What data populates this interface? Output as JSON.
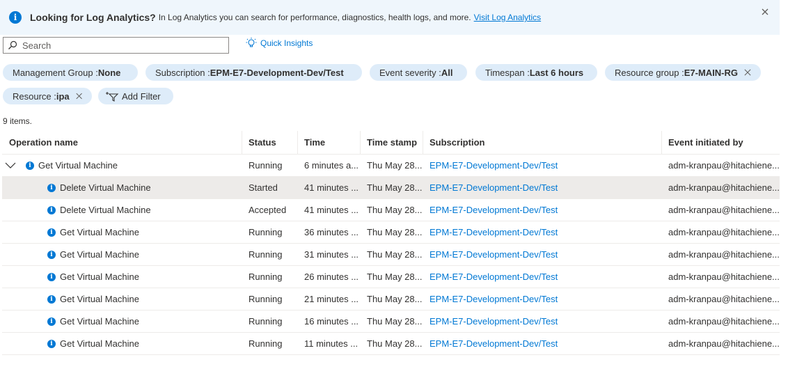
{
  "banner": {
    "title": "Looking for Log Analytics?",
    "message": "In Log Analytics you can search for performance, diagnostics, health logs, and more.",
    "link": "Visit Log Analytics"
  },
  "search": {
    "placeholder": "Search"
  },
  "quick_insights": "Quick Insights",
  "filters": {
    "management_group": {
      "label": "Management Group : ",
      "value": "None"
    },
    "subscription": {
      "label": "Subscription : ",
      "value": "EPM-E7-Development-Dev/Test"
    },
    "event_severity": {
      "label": "Event severity : ",
      "value": "All"
    },
    "timespan": {
      "label": "Timespan : ",
      "value": "Last 6 hours"
    },
    "resource_group": {
      "label": "Resource group : ",
      "value": "E7-MAIN-RG"
    },
    "resource": {
      "label": "Resource : ",
      "value": "ipa"
    },
    "add_filter": "Add Filter"
  },
  "item_count": "9 items.",
  "columns": [
    "Operation name",
    "Status",
    "Time",
    "Time stamp",
    "Subscription",
    "Event initiated by"
  ],
  "rows": [
    {
      "op": "Get Virtual Machine",
      "status": "Running",
      "time": "6 minutes a...",
      "stamp": "Thu May 28...",
      "sub": "EPM-E7-Development-Dev/Test",
      "by": "adm-kranpau@hitachiene..."
    },
    {
      "op": "Delete Virtual Machine",
      "status": "Started",
      "time": "41 minutes ...",
      "stamp": "Thu May 28...",
      "sub": "EPM-E7-Development-Dev/Test",
      "by": "adm-kranpau@hitachiene..."
    },
    {
      "op": "Delete Virtual Machine",
      "status": "Accepted",
      "time": "41 minutes ...",
      "stamp": "Thu May 28...",
      "sub": "EPM-E7-Development-Dev/Test",
      "by": "adm-kranpau@hitachiene..."
    },
    {
      "op": "Get Virtual Machine",
      "status": "Running",
      "time": "36 minutes ...",
      "stamp": "Thu May 28...",
      "sub": "EPM-E7-Development-Dev/Test",
      "by": "adm-kranpau@hitachiene..."
    },
    {
      "op": "Get Virtual Machine",
      "status": "Running",
      "time": "31 minutes ...",
      "stamp": "Thu May 28...",
      "sub": "EPM-E7-Development-Dev/Test",
      "by": "adm-kranpau@hitachiene..."
    },
    {
      "op": "Get Virtual Machine",
      "status": "Running",
      "time": "26 minutes ...",
      "stamp": "Thu May 28...",
      "sub": "EPM-E7-Development-Dev/Test",
      "by": "adm-kranpau@hitachiene..."
    },
    {
      "op": "Get Virtual Machine",
      "status": "Running",
      "time": "21 minutes ...",
      "stamp": "Thu May 28...",
      "sub": "EPM-E7-Development-Dev/Test",
      "by": "adm-kranpau@hitachiene..."
    },
    {
      "op": "Get Virtual Machine",
      "status": "Running",
      "time": "16 minutes ...",
      "stamp": "Thu May 28...",
      "sub": "EPM-E7-Development-Dev/Test",
      "by": "adm-kranpau@hitachiene..."
    },
    {
      "op": "Get Virtual Machine",
      "status": "Running",
      "time": "11 minutes ...",
      "stamp": "Thu May 28...",
      "sub": "EPM-E7-Development-Dev/Test",
      "by": "adm-kranpau@hitachiene..."
    }
  ],
  "colors": {
    "accent": "#0078d4",
    "pill_bg": "#deecf9",
    "banner_bg": "#eff6fc",
    "selected_row": "#edebe9"
  }
}
